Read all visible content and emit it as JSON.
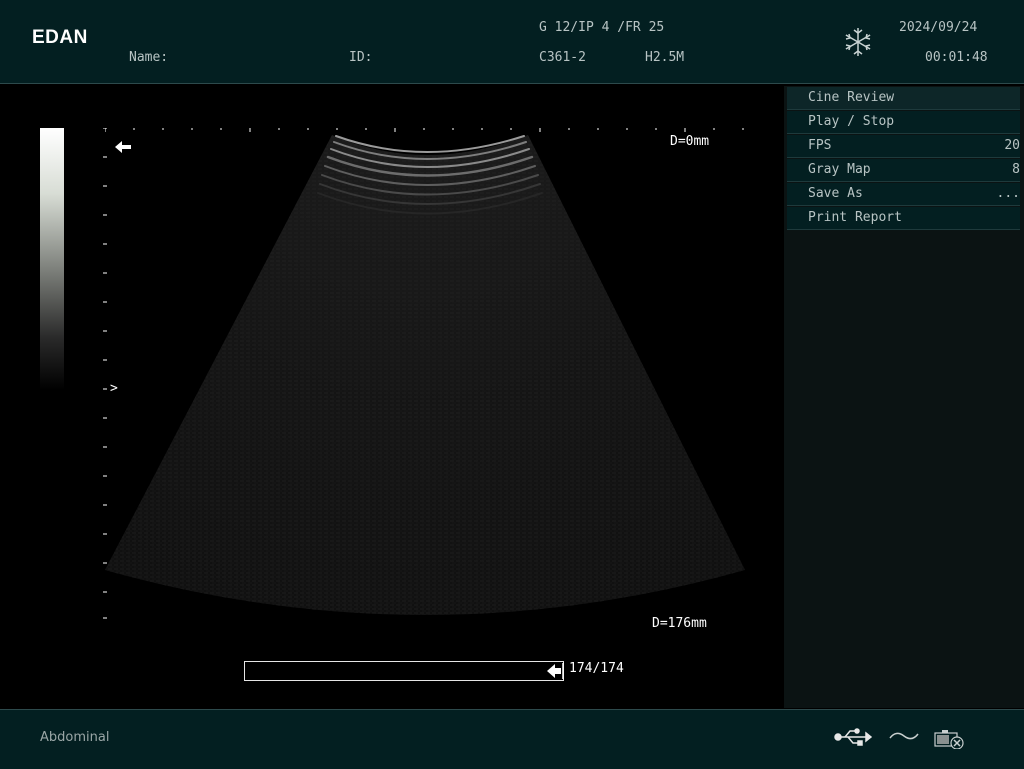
{
  "header": {
    "brand": "EDAN",
    "name_label": "Name:",
    "id_label": "ID:",
    "params": "G 12/IP 4 /FR 25",
    "probe": "C361-2",
    "frequency": "H2.5M",
    "date": "2024/09/24",
    "time": "00:01:48",
    "freeze_icon": "snowflake-icon"
  },
  "image": {
    "depth_top": "D=0mm",
    "depth_bottom": "D=176mm",
    "focus_marker": ">",
    "orientation_icon": "left-arrow-icon",
    "cine_counter": "174/174",
    "cine_progress": 1.0
  },
  "menu": {
    "items": [
      {
        "label": "Cine Review",
        "value": ""
      },
      {
        "label": "Play / Stop",
        "value": ""
      },
      {
        "label": "FPS",
        "value": "20"
      },
      {
        "label": "Gray Map",
        "value": "8"
      },
      {
        "label": "Save As",
        "value": "..."
      },
      {
        "label": "Print Report",
        "value": ""
      }
    ]
  },
  "footer": {
    "exam_preset": "Abdominal",
    "icons": [
      "usb-icon",
      "ac-power-icon",
      "video-record-icon"
    ]
  },
  "colors": {
    "bar_bg": "#031f21",
    "text": "#b8c4c4",
    "image_bg": "#000000"
  }
}
